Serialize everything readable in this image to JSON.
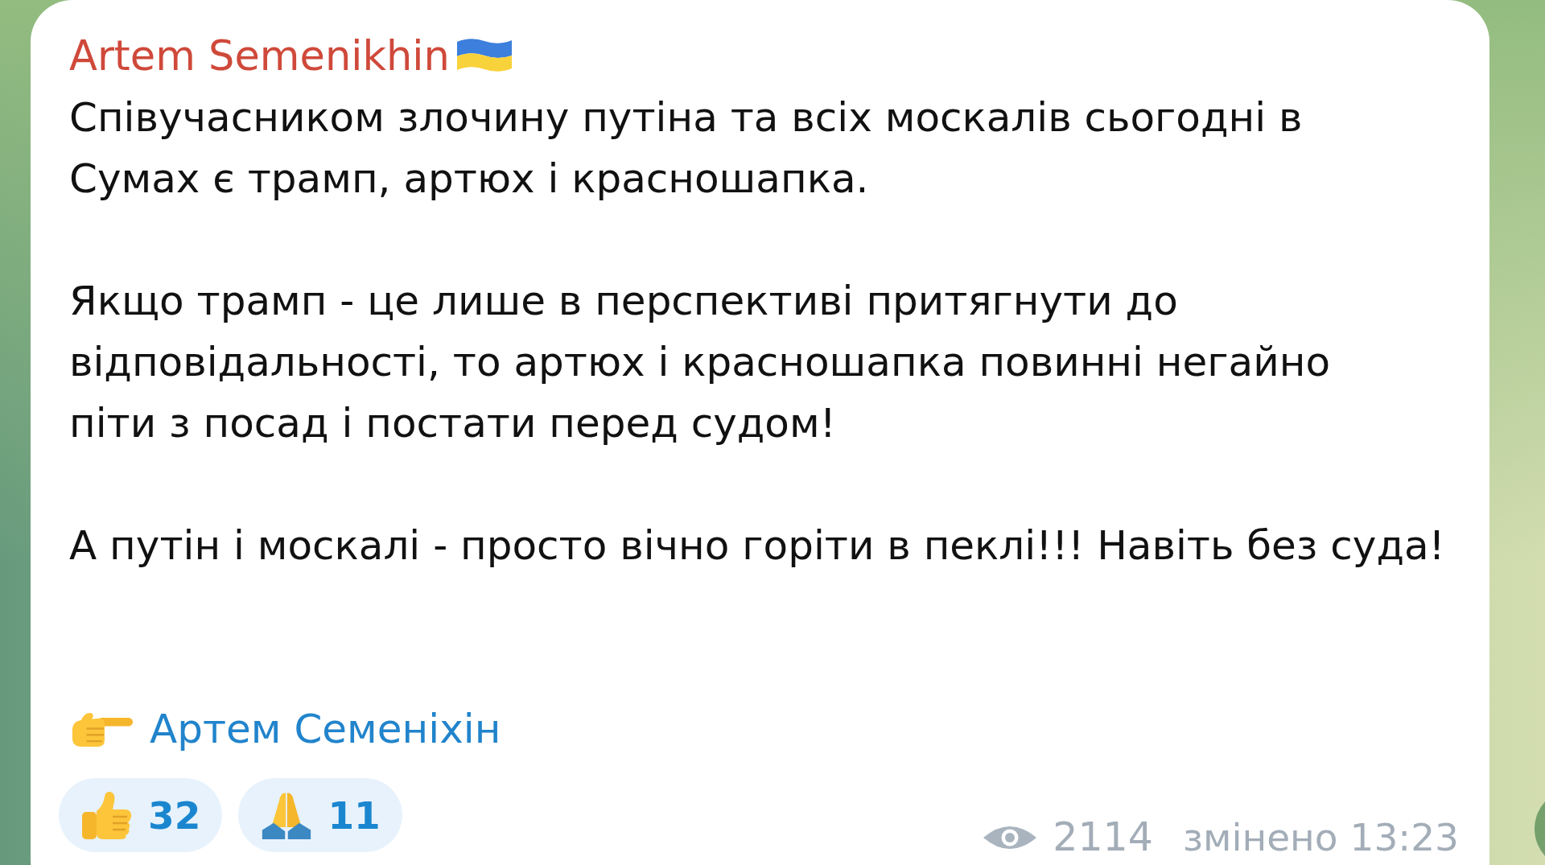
{
  "message": {
    "author": "Artem Semenikhin",
    "paragraphs": [
      "Співучасником злочину путіна та всіх москалів сьогодні в\nСумах є трамп, артюх і красношапка.",
      "Якщо трамп - це лише в перспективі притягнути до\nвідповідальності, то артюх і красношапка повинні негайно\nпіти з посад і постати перед судом!",
      "А путін і москалі - просто вічно горіти в пеклі!!! Навіть без суда!"
    ],
    "signature_link": "Артем Семеніхін",
    "reactions": [
      {
        "kind": "thumbs_up",
        "count": "32",
        "selected": false
      },
      {
        "kind": "folded_hands",
        "count": "11",
        "selected": false
      }
    ],
    "views": "2114",
    "timestamp": "змінено 13:23"
  }
}
